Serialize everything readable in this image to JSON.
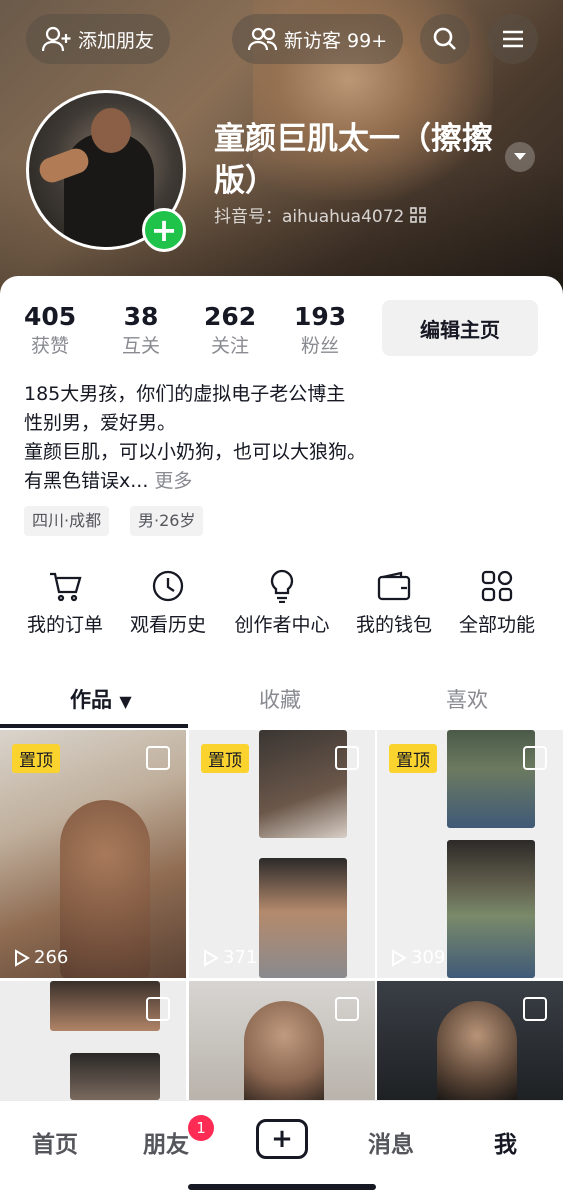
{
  "header": {
    "add_friend": "添加朋友",
    "visitors": "新访客 99+",
    "nickname": "童颜巨肌太一（擦擦版）",
    "douyin_id": "抖音号：aihuahua4072"
  },
  "stats": [
    {
      "num": "405",
      "label": "获赞"
    },
    {
      "num": "38",
      "label": "互关"
    },
    {
      "num": "262",
      "label": "关注"
    },
    {
      "num": "193",
      "label": "粉丝"
    }
  ],
  "edit_profile": "编辑主页",
  "bio": {
    "line1": "185大男孩，你们的虚拟电子老公博主",
    "line2": "性别男，爱好男。",
    "line3": "童颜巨肌，可以小奶狗，也可以大狼狗。",
    "line4": "有黑色错误x...",
    "more": "更多"
  },
  "tags": [
    "四川·成都",
    "男·26岁"
  ],
  "features": [
    {
      "label": "我的订单",
      "icon": "cart-icon"
    },
    {
      "label": "观看历史",
      "icon": "clock-icon"
    },
    {
      "label": "创作者中心",
      "icon": "lightbulb-icon"
    },
    {
      "label": "我的钱包",
      "icon": "wallet-icon"
    },
    {
      "label": "全部功能",
      "icon": "grid-icon"
    }
  ],
  "tabs": [
    "作品",
    "收藏",
    "喜欢"
  ],
  "videos": [
    {
      "pinned": "置顶",
      "plays": "266"
    },
    {
      "pinned": "置顶",
      "plays": "371"
    },
    {
      "pinned": "置顶",
      "plays": "309"
    }
  ],
  "nav": {
    "home": "首页",
    "friends": "朋友",
    "friends_badge": "1",
    "messages": "消息",
    "me": "我"
  },
  "colors": {
    "accent": "#fe2c55",
    "pin": "#fbd32f",
    "follow_green": "#1fc34a"
  }
}
